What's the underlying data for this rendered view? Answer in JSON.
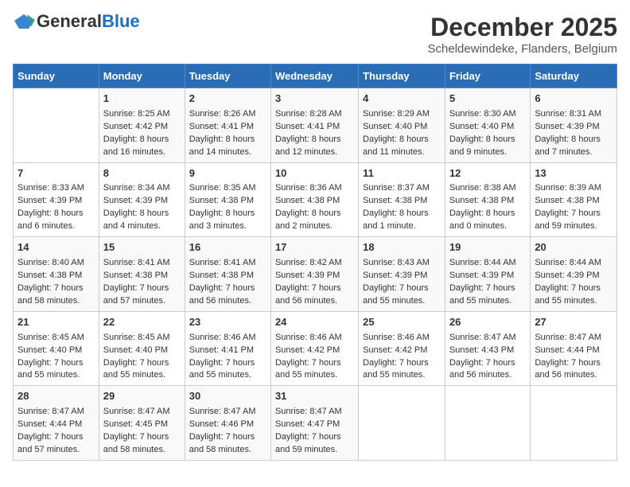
{
  "logo": {
    "general": "General",
    "blue": "Blue"
  },
  "header": {
    "month": "December 2025",
    "location": "Scheldewindeke, Flanders, Belgium"
  },
  "days_of_week": [
    "Sunday",
    "Monday",
    "Tuesday",
    "Wednesday",
    "Thursday",
    "Friday",
    "Saturday"
  ],
  "weeks": [
    [
      {
        "day": "",
        "content": ""
      },
      {
        "day": "1",
        "content": "Sunrise: 8:25 AM\nSunset: 4:42 PM\nDaylight: 8 hours\nand 16 minutes."
      },
      {
        "day": "2",
        "content": "Sunrise: 8:26 AM\nSunset: 4:41 PM\nDaylight: 8 hours\nand 14 minutes."
      },
      {
        "day": "3",
        "content": "Sunrise: 8:28 AM\nSunset: 4:41 PM\nDaylight: 8 hours\nand 12 minutes."
      },
      {
        "day": "4",
        "content": "Sunrise: 8:29 AM\nSunset: 4:40 PM\nDaylight: 8 hours\nand 11 minutes."
      },
      {
        "day": "5",
        "content": "Sunrise: 8:30 AM\nSunset: 4:40 PM\nDaylight: 8 hours\nand 9 minutes."
      },
      {
        "day": "6",
        "content": "Sunrise: 8:31 AM\nSunset: 4:39 PM\nDaylight: 8 hours\nand 7 minutes."
      }
    ],
    [
      {
        "day": "7",
        "content": "Sunrise: 8:33 AM\nSunset: 4:39 PM\nDaylight: 8 hours\nand 6 minutes."
      },
      {
        "day": "8",
        "content": "Sunrise: 8:34 AM\nSunset: 4:39 PM\nDaylight: 8 hours\nand 4 minutes."
      },
      {
        "day": "9",
        "content": "Sunrise: 8:35 AM\nSunset: 4:38 PM\nDaylight: 8 hours\nand 3 minutes."
      },
      {
        "day": "10",
        "content": "Sunrise: 8:36 AM\nSunset: 4:38 PM\nDaylight: 8 hours\nand 2 minutes."
      },
      {
        "day": "11",
        "content": "Sunrise: 8:37 AM\nSunset: 4:38 PM\nDaylight: 8 hours\nand 1 minute."
      },
      {
        "day": "12",
        "content": "Sunrise: 8:38 AM\nSunset: 4:38 PM\nDaylight: 8 hours\nand 0 minutes."
      },
      {
        "day": "13",
        "content": "Sunrise: 8:39 AM\nSunset: 4:38 PM\nDaylight: 7 hours\nand 59 minutes."
      }
    ],
    [
      {
        "day": "14",
        "content": "Sunrise: 8:40 AM\nSunset: 4:38 PM\nDaylight: 7 hours\nand 58 minutes."
      },
      {
        "day": "15",
        "content": "Sunrise: 8:41 AM\nSunset: 4:38 PM\nDaylight: 7 hours\nand 57 minutes."
      },
      {
        "day": "16",
        "content": "Sunrise: 8:41 AM\nSunset: 4:38 PM\nDaylight: 7 hours\nand 56 minutes."
      },
      {
        "day": "17",
        "content": "Sunrise: 8:42 AM\nSunset: 4:39 PM\nDaylight: 7 hours\nand 56 minutes."
      },
      {
        "day": "18",
        "content": "Sunrise: 8:43 AM\nSunset: 4:39 PM\nDaylight: 7 hours\nand 55 minutes."
      },
      {
        "day": "19",
        "content": "Sunrise: 8:44 AM\nSunset: 4:39 PM\nDaylight: 7 hours\nand 55 minutes."
      },
      {
        "day": "20",
        "content": "Sunrise: 8:44 AM\nSunset: 4:39 PM\nDaylight: 7 hours\nand 55 minutes."
      }
    ],
    [
      {
        "day": "21",
        "content": "Sunrise: 8:45 AM\nSunset: 4:40 PM\nDaylight: 7 hours\nand 55 minutes."
      },
      {
        "day": "22",
        "content": "Sunrise: 8:45 AM\nSunset: 4:40 PM\nDaylight: 7 hours\nand 55 minutes."
      },
      {
        "day": "23",
        "content": "Sunrise: 8:46 AM\nSunset: 4:41 PM\nDaylight: 7 hours\nand 55 minutes."
      },
      {
        "day": "24",
        "content": "Sunrise: 8:46 AM\nSunset: 4:42 PM\nDaylight: 7 hours\nand 55 minutes."
      },
      {
        "day": "25",
        "content": "Sunrise: 8:46 AM\nSunset: 4:42 PM\nDaylight: 7 hours\nand 55 minutes."
      },
      {
        "day": "26",
        "content": "Sunrise: 8:47 AM\nSunset: 4:43 PM\nDaylight: 7 hours\nand 56 minutes."
      },
      {
        "day": "27",
        "content": "Sunrise: 8:47 AM\nSunset: 4:44 PM\nDaylight: 7 hours\nand 56 minutes."
      }
    ],
    [
      {
        "day": "28",
        "content": "Sunrise: 8:47 AM\nSunset: 4:44 PM\nDaylight: 7 hours\nand 57 minutes."
      },
      {
        "day": "29",
        "content": "Sunrise: 8:47 AM\nSunset: 4:45 PM\nDaylight: 7 hours\nand 58 minutes."
      },
      {
        "day": "30",
        "content": "Sunrise: 8:47 AM\nSunset: 4:46 PM\nDaylight: 7 hours\nand 58 minutes."
      },
      {
        "day": "31",
        "content": "Sunrise: 8:47 AM\nSunset: 4:47 PM\nDaylight: 7 hours\nand 59 minutes."
      },
      {
        "day": "",
        "content": ""
      },
      {
        "day": "",
        "content": ""
      },
      {
        "day": "",
        "content": ""
      }
    ]
  ]
}
